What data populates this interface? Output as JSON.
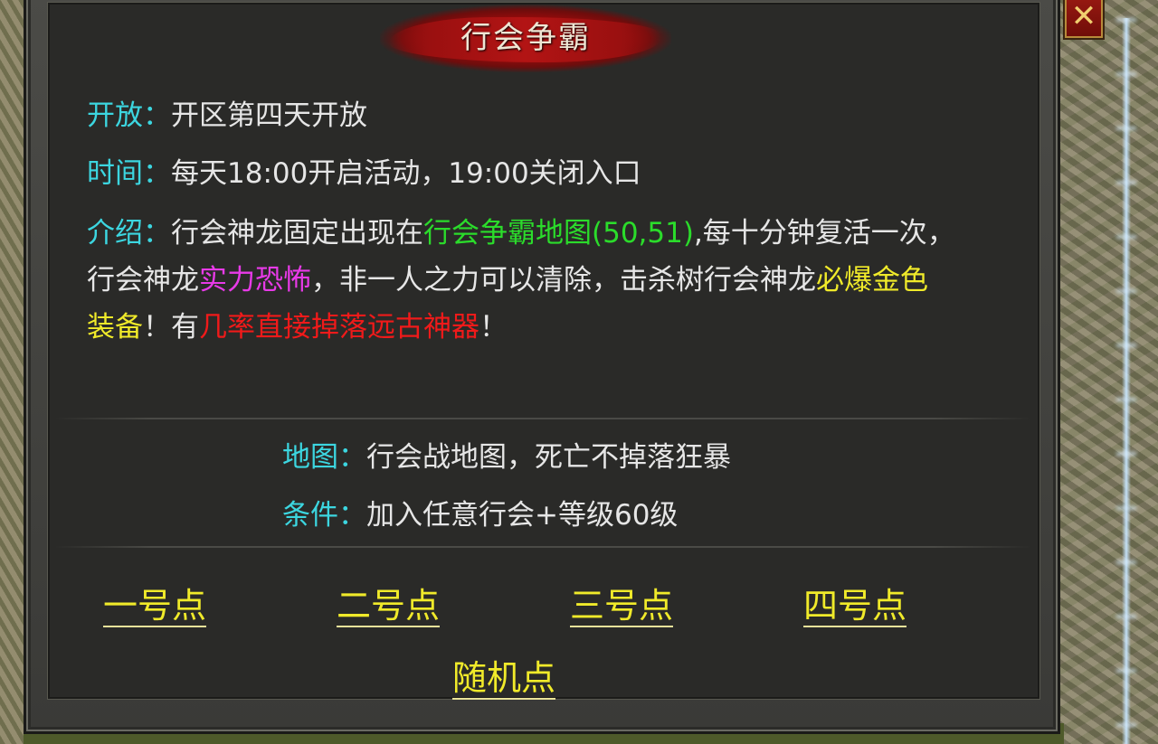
{
  "panel": {
    "title": "行会争霸",
    "close_glyph": "✕"
  },
  "info": {
    "open_label": "开放：",
    "open_value": "开区第四天开放",
    "time_label": "时间：",
    "time_value": "每天18:00开启活动，19:00关闭入口",
    "intro_label": "介绍：",
    "intro_seg1": "行会神龙固定出现在",
    "intro_seg2": "行会争霸地图(50,51)",
    "intro_seg3": ",每十分钟复活一次，",
    "intro_seg4": "行会神龙",
    "intro_seg5": "实力恐怖",
    "intro_seg6": "，非一人之力可以清除，击杀树行会神龙",
    "intro_seg7": "必爆金色",
    "intro_seg8": "装备",
    "intro_seg9": "！有",
    "intro_seg10": "几率直接掉落远古神器",
    "intro_seg11": "！"
  },
  "requirements": {
    "map_label": "地图：",
    "map_value": "行会战地图，死亡不掉落狂暴",
    "cond_label": "条件：",
    "cond_value": "加入任意行会+等级60级"
  },
  "teleports": {
    "point1": "一号点",
    "point2": "二号点",
    "point3": "三号点",
    "point4": "四号点",
    "random": "随机点"
  },
  "colors": {
    "label_cyan": "#3cd6e0",
    "link_yellow": "#f0ea2a",
    "highlight_green": "#2bdc2b",
    "highlight_magenta": "#e83ae8",
    "highlight_red": "#f01a1a",
    "title_red": "#b21414"
  }
}
